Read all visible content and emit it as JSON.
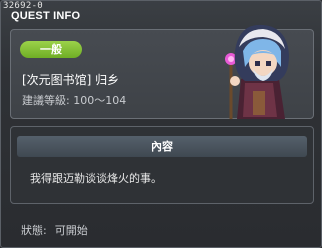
{
  "window": {
    "quest_id": "32692-0",
    "title": "QUEST INFO"
  },
  "summary": {
    "difficulty": "一般",
    "quest_name": "[次元图书馆] 归乡",
    "level_requirement": "建議等級: 100〜104",
    "npc_portrait_icon": "hooded-npc-portrait"
  },
  "content": {
    "header": "內容",
    "text": "我得跟迈勒谈谈烽火的事。"
  },
  "status": {
    "label": "狀態:",
    "value": "可開始"
  },
  "colors": {
    "difficulty_badge": "#8cc63f",
    "title_text": "#ffffff",
    "panel_bg": "#43474c"
  }
}
